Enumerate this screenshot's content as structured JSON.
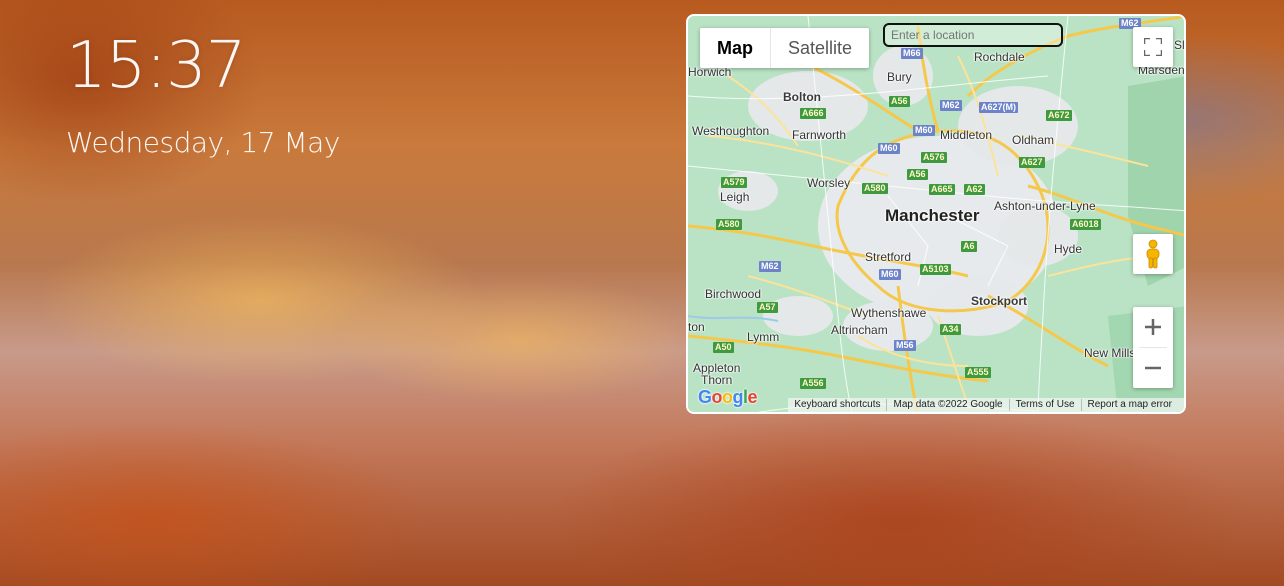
{
  "clock": {
    "time": "15:37",
    "date": "Wednesday, 17 May"
  },
  "map": {
    "map_type_options": [
      "Map",
      "Satellite"
    ],
    "selected_map_type": "Map",
    "search": {
      "placeholder": "Enter a location",
      "value": ""
    },
    "controls": {
      "fullscreen_icon": "fullscreen-icon",
      "pegman_icon": "pegman-icon",
      "zoom_in_icon": "plus-icon",
      "zoom_out_icon": "minus-icon"
    },
    "logo_text": "Google",
    "attribution": [
      "Keyboard shortcuts",
      "Map data ©2022 Google",
      "Terms of Use",
      "Report a map error"
    ],
    "places": {
      "horwich": "Horwich",
      "bolton": "Bolton",
      "bury": "Bury",
      "rochdale": "Rochdale",
      "westhoughton": "Westhoughton",
      "farnworth": "Farnworth",
      "middleton": "Middleton",
      "oldham": "Oldham",
      "leigh": "Leigh",
      "worsley": "Worsley",
      "manchester": "Manchester",
      "ashton": "Ashton-under-Lyne",
      "hyde": "Hyde",
      "stretford": "Stretford",
      "birchwood": "Birchwood",
      "wythenshawe": "Wythenshawe",
      "stockport": "Stockport",
      "lymm": "Lymm",
      "altrincham": "Altrincham",
      "new_mills": "New Mills",
      "appleton": "Appleton",
      "thorn": "Thorn",
      "marsden": "Marsden",
      "sla": "Sla",
      "ton": "ton"
    },
    "roads": {
      "m62_top": "M62",
      "m66": "M66",
      "a56_top": "A56",
      "m62_mid": "M62",
      "a627m": "A627(M)",
      "a672": "A672",
      "a666": "A666",
      "m60_top": "M60",
      "m60_left": "M60",
      "a576": "A576",
      "a627": "A627",
      "a56_mid": "A56",
      "a579": "A579",
      "a580": "A580",
      "a665": "A665",
      "a62": "A62",
      "a6018": "A6018",
      "a580_left": "A580",
      "a6": "A6",
      "m62_low": "M62",
      "m60_low": "M60",
      "a5103": "A5103",
      "a57": "A57",
      "a34": "A34",
      "m56": "M56",
      "a50": "A50",
      "a556": "A556",
      "a555": "A555"
    }
  },
  "colors": {
    "map_green": "#a8dbb5",
    "map_road_yellow": "#f7d36a",
    "map_urban": "#e5e8ea"
  }
}
